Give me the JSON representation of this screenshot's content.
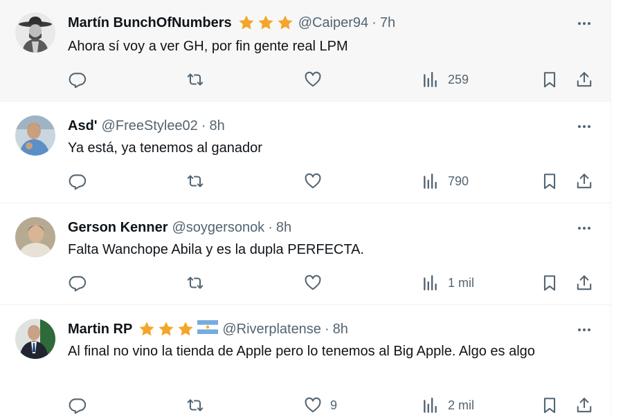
{
  "tweets": [
    {
      "name": "Martín BunchOfNumbers",
      "stars": 3,
      "flag": false,
      "handle": "@Caiper94",
      "dot": "·",
      "time": "7h",
      "text": "Ahora sí voy a ver GH, por fin gente real LPM",
      "likes": "",
      "views": "259",
      "avatar_icon": "cowboy-portrait-avatar",
      "hover": true
    },
    {
      "name": "Asd'",
      "stars": 0,
      "flag": false,
      "handle": "@FreeStylee02",
      "dot": "·",
      "time": "8h",
      "text": "Ya está, ya tenemos al ganador",
      "likes": "",
      "views": "790",
      "avatar_icon": "man-in-blue-avatar",
      "hover": false
    },
    {
      "name": "Gerson Kenner",
      "stars": 0,
      "flag": false,
      "handle": "@soygersonok",
      "dot": "·",
      "time": "8h",
      "text": "Falta Wanchope Abila y es la dupla PERFECTA.",
      "likes": "",
      "views": "1 mil",
      "avatar_icon": "man-portrait-avatar",
      "hover": false
    },
    {
      "name": "Martin RP",
      "stars": 3,
      "flag": true,
      "handle": "@Riverplatense",
      "dot": "·",
      "time": "8h",
      "text": "Al final no vino la tienda de Apple pero lo tenemos al Big Apple. Algo es algo",
      "likes": "9",
      "views": "2 mil",
      "avatar_icon": "man-in-suit-avatar",
      "hover": false
    }
  ],
  "colors": {
    "text": "#0f1419",
    "secondary": "#536471",
    "star": "#f4a52a",
    "hover_bg": "#f7f7f7",
    "divider": "#eff3f4",
    "flag_blue": "#74acdf",
    "flag_sun": "#f6b40e"
  }
}
